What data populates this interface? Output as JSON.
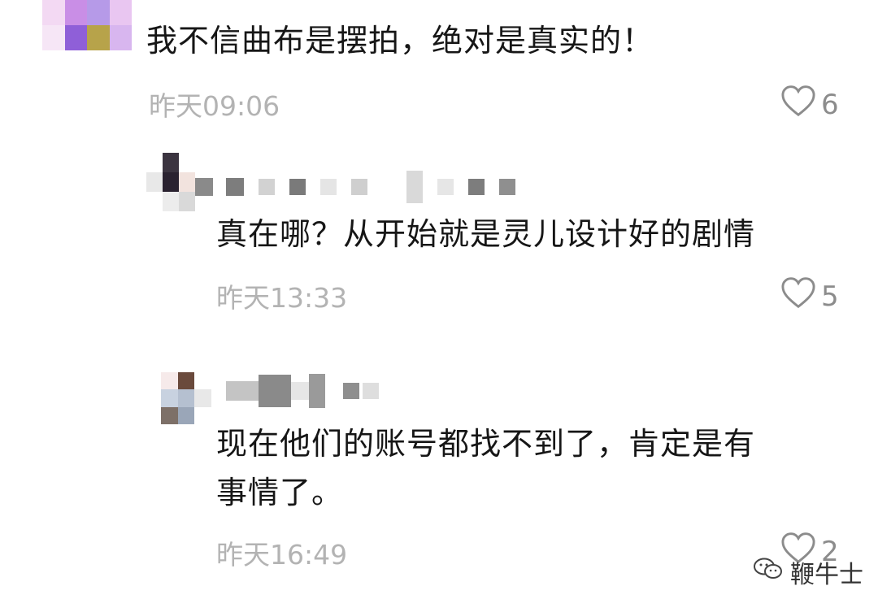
{
  "comments": [
    {
      "text": "我不信曲布是摆拍，绝对是真实的！",
      "time": "昨天09:06",
      "likes": "6"
    },
    {
      "text": "真在哪？从开始就是灵儿设计好的剧情",
      "time": "昨天13:33",
      "likes": "5"
    },
    {
      "text_line1": "现在他们的账号都找不到了，肯定是有",
      "text_line2": "事情了。",
      "time": "昨天16:49",
      "likes": "2"
    }
  ],
  "watermark": {
    "label": "鞭牛士",
    "icon": "wechat-icon"
  },
  "icons": {
    "like": "heart-outline-icon"
  },
  "colors": {
    "text": "#161616",
    "meta": "#b3b3b3",
    "like": "#8c8c8c"
  }
}
